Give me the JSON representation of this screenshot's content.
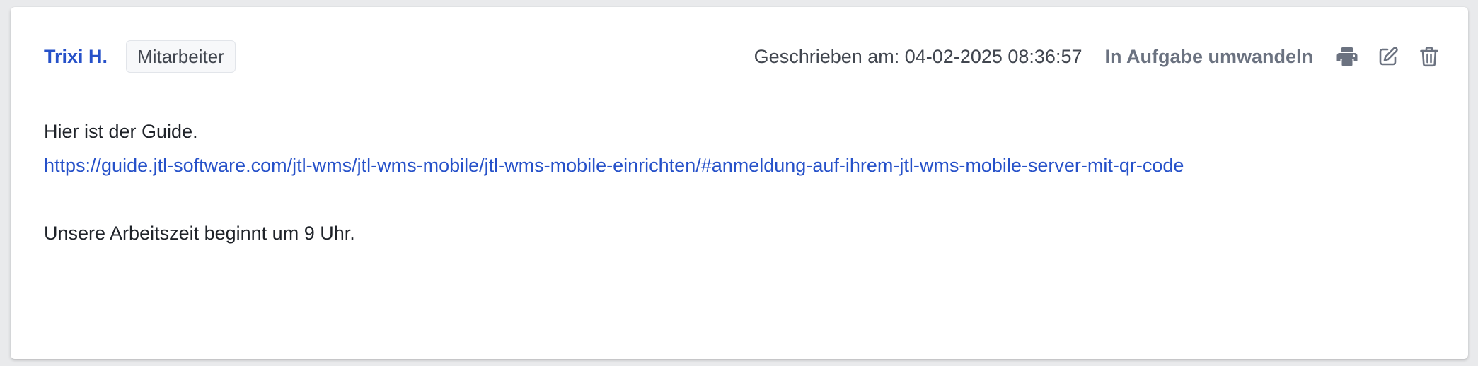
{
  "note": {
    "author": "Trixi H.",
    "role": "Mitarbeiter",
    "written_at": "Geschrieben am: 04-02-2025 08:36:57",
    "convert_label": "In Aufgabe umwandeln",
    "actions": {
      "print_icon": "printer-icon",
      "edit_icon": "edit-icon",
      "delete_icon": "trash-icon"
    },
    "content": {
      "line1": "Hier ist der Guide.",
      "link": "https://guide.jtl-software.com/jtl-wms/jtl-wms-mobile/jtl-wms-mobile-einrichten/#anmeldung-auf-ihrem-jtl-wms-mobile-server-mit-qr-code",
      "line3": "Unsere Arbeitszeit beginnt um 9 Uhr."
    }
  },
  "colors": {
    "link": "#2651c9",
    "icon": "#6b7280",
    "text": "#1f2329"
  }
}
